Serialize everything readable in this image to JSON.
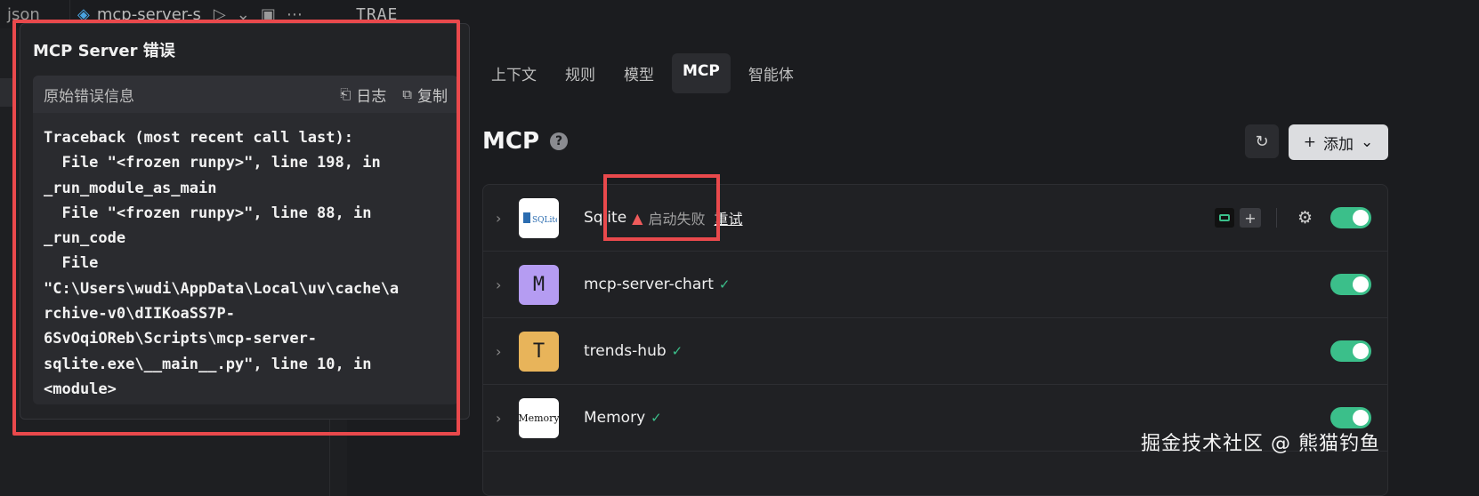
{
  "editor": {
    "tab_json": "json",
    "tab_active": "mcp-server-s",
    "top_right_label": "TRAE"
  },
  "error_popover": {
    "title": "MCP Server 错误",
    "panel_title": "原始错误信息",
    "log_label": "日志",
    "copy_label": "复制",
    "traceback": "Traceback (most recent call last):\n  File \"<frozen runpy>\", line 198, in\n_run_module_as_main\n  File \"<frozen runpy>\", line 88, in\n_run_code\n  File\n\"C:\\Users\\wudi\\AppData\\Local\\uv\\cache\\a\nrchive-v0\\dIIKoaSS7P-\n6SvOqiORеb\\Scripts\\mcp-server-\nsqlite.exe\\__main__.py\", line 10, in\n<module>"
  },
  "nav": {
    "tabs": [
      {
        "label": "上下文"
      },
      {
        "label": "规则"
      },
      {
        "label": "模型"
      },
      {
        "label": "MCP"
      },
      {
        "label": "智能体"
      }
    ],
    "active": "MCP"
  },
  "mcp": {
    "title": "MCP",
    "help": "?",
    "add_label": "添加"
  },
  "servers": [
    {
      "name": "Sqlite",
      "avatar": "SQLite",
      "status": "启动失败",
      "retry": "重试",
      "enabled": true
    },
    {
      "name": "mcp-server-chart",
      "avatar": "M",
      "status": "ok",
      "enabled": true
    },
    {
      "name": "trends-hub",
      "avatar": "T",
      "status": "ok",
      "enabled": true
    },
    {
      "name": "Memory",
      "avatar": "Memory",
      "status": "ok",
      "enabled": true
    }
  ],
  "colors": {
    "accent_green": "#3bbf8a",
    "annotation_red": "#e9494c",
    "avatar_purple": "#b59cf2",
    "avatar_yellow": "#e8b45a"
  },
  "watermark": "掘金技术社区 @ 熊猫钓鱼"
}
